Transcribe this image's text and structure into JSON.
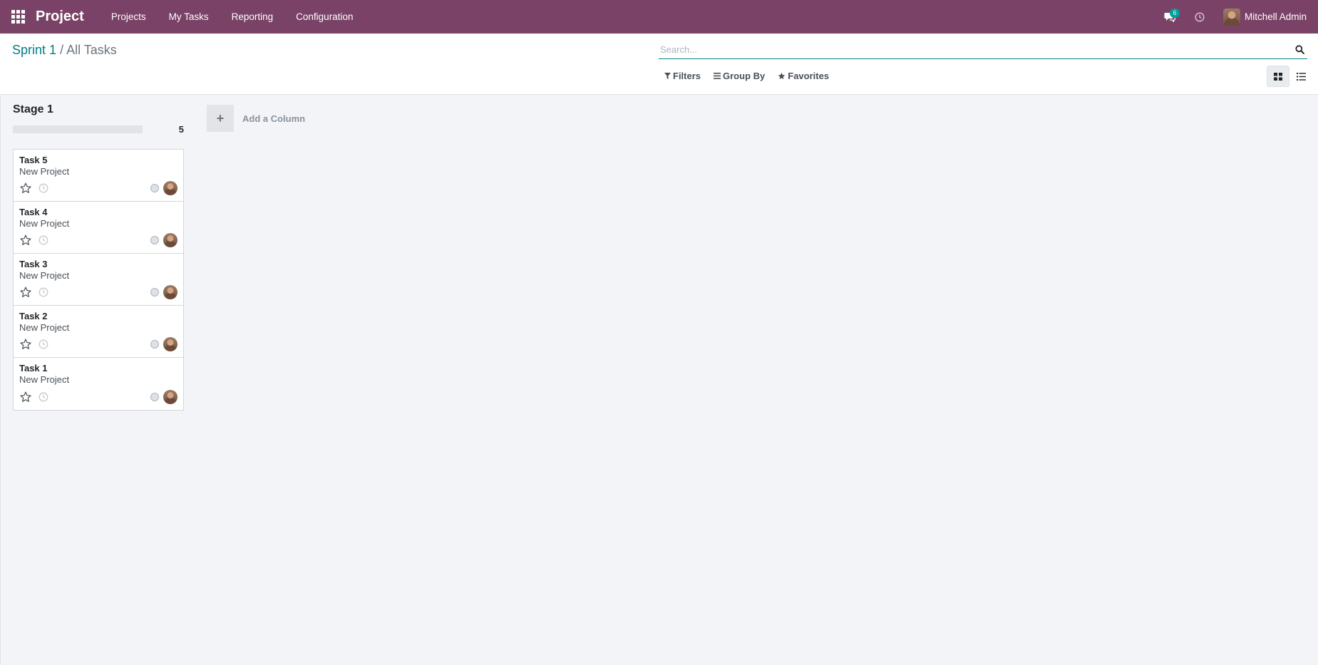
{
  "navbar": {
    "app_name": "Project",
    "menu": [
      "Projects",
      "My Tasks",
      "Reporting",
      "Configuration"
    ],
    "messages_badge": "6",
    "user_name": "Mitchell Admin",
    "bg_color": "#7a4266"
  },
  "breadcrumb": {
    "parent": "Sprint 1",
    "separator": "/",
    "current": "All Tasks"
  },
  "search": {
    "placeholder": "Search..."
  },
  "filters": {
    "filters_label": "Filters",
    "group_by_label": "Group By",
    "favorites_label": "Favorites"
  },
  "views": [
    "kanban",
    "list"
  ],
  "kanban": {
    "columns": [
      {
        "title": "Stage 1",
        "count": "5",
        "cards": [
          {
            "title": "Task 5",
            "project": "New Project"
          },
          {
            "title": "Task 4",
            "project": "New Project"
          },
          {
            "title": "Task 3",
            "project": "New Project"
          },
          {
            "title": "Task 2",
            "project": "New Project"
          },
          {
            "title": "Task 1",
            "project": "New Project"
          }
        ]
      }
    ],
    "add_column_label": "Add a Column"
  }
}
